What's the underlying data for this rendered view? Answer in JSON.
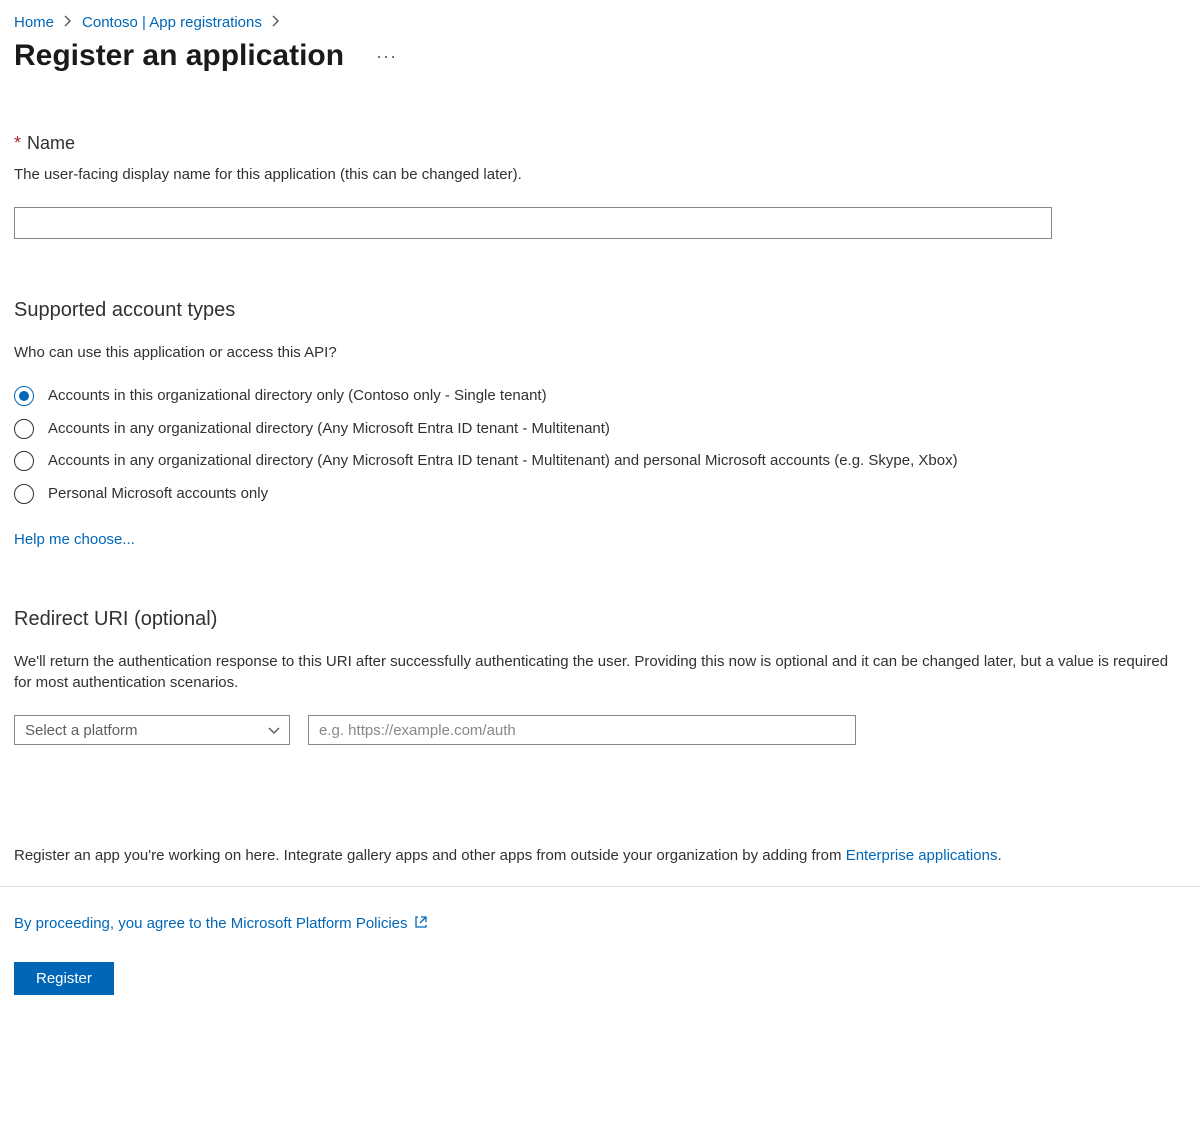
{
  "breadcrumb": {
    "home": "Home",
    "contoso": "Contoso | App registrations"
  },
  "page_title": "Register an application",
  "name_section": {
    "label": "Name",
    "description": "The user-facing display name for this application (this can be changed later).",
    "value": ""
  },
  "account_types": {
    "heading": "Supported account types",
    "question": "Who can use this application or access this API?",
    "options": [
      {
        "label": "Accounts in this organizational directory only (Contoso only - Single tenant)",
        "selected": true
      },
      {
        "label": "Accounts in any organizational directory (Any Microsoft Entra ID tenant - Multitenant)",
        "selected": false
      },
      {
        "label": "Accounts in any organizational directory (Any Microsoft Entra ID tenant - Multitenant) and personal Microsoft accounts (e.g. Skype, Xbox)",
        "selected": false
      },
      {
        "label": "Personal Microsoft accounts only",
        "selected": false
      }
    ],
    "help_link": "Help me choose..."
  },
  "redirect": {
    "heading": "Redirect URI (optional)",
    "description": "We'll return the authentication response to this URI after successfully authenticating the user. Providing this now is optional and it can be changed later, but a value is required for most authentication scenarios.",
    "platform_placeholder": "Select a platform",
    "uri_placeholder": "e.g. https://example.com/auth"
  },
  "footer": {
    "note_prefix": "Register an app you're working on here. Integrate gallery apps and other apps from outside your organization by adding from ",
    "note_link": "Enterprise applications",
    "note_suffix": ".",
    "policy_text": "By proceeding, you agree to the Microsoft Platform Policies",
    "register_button": "Register"
  }
}
